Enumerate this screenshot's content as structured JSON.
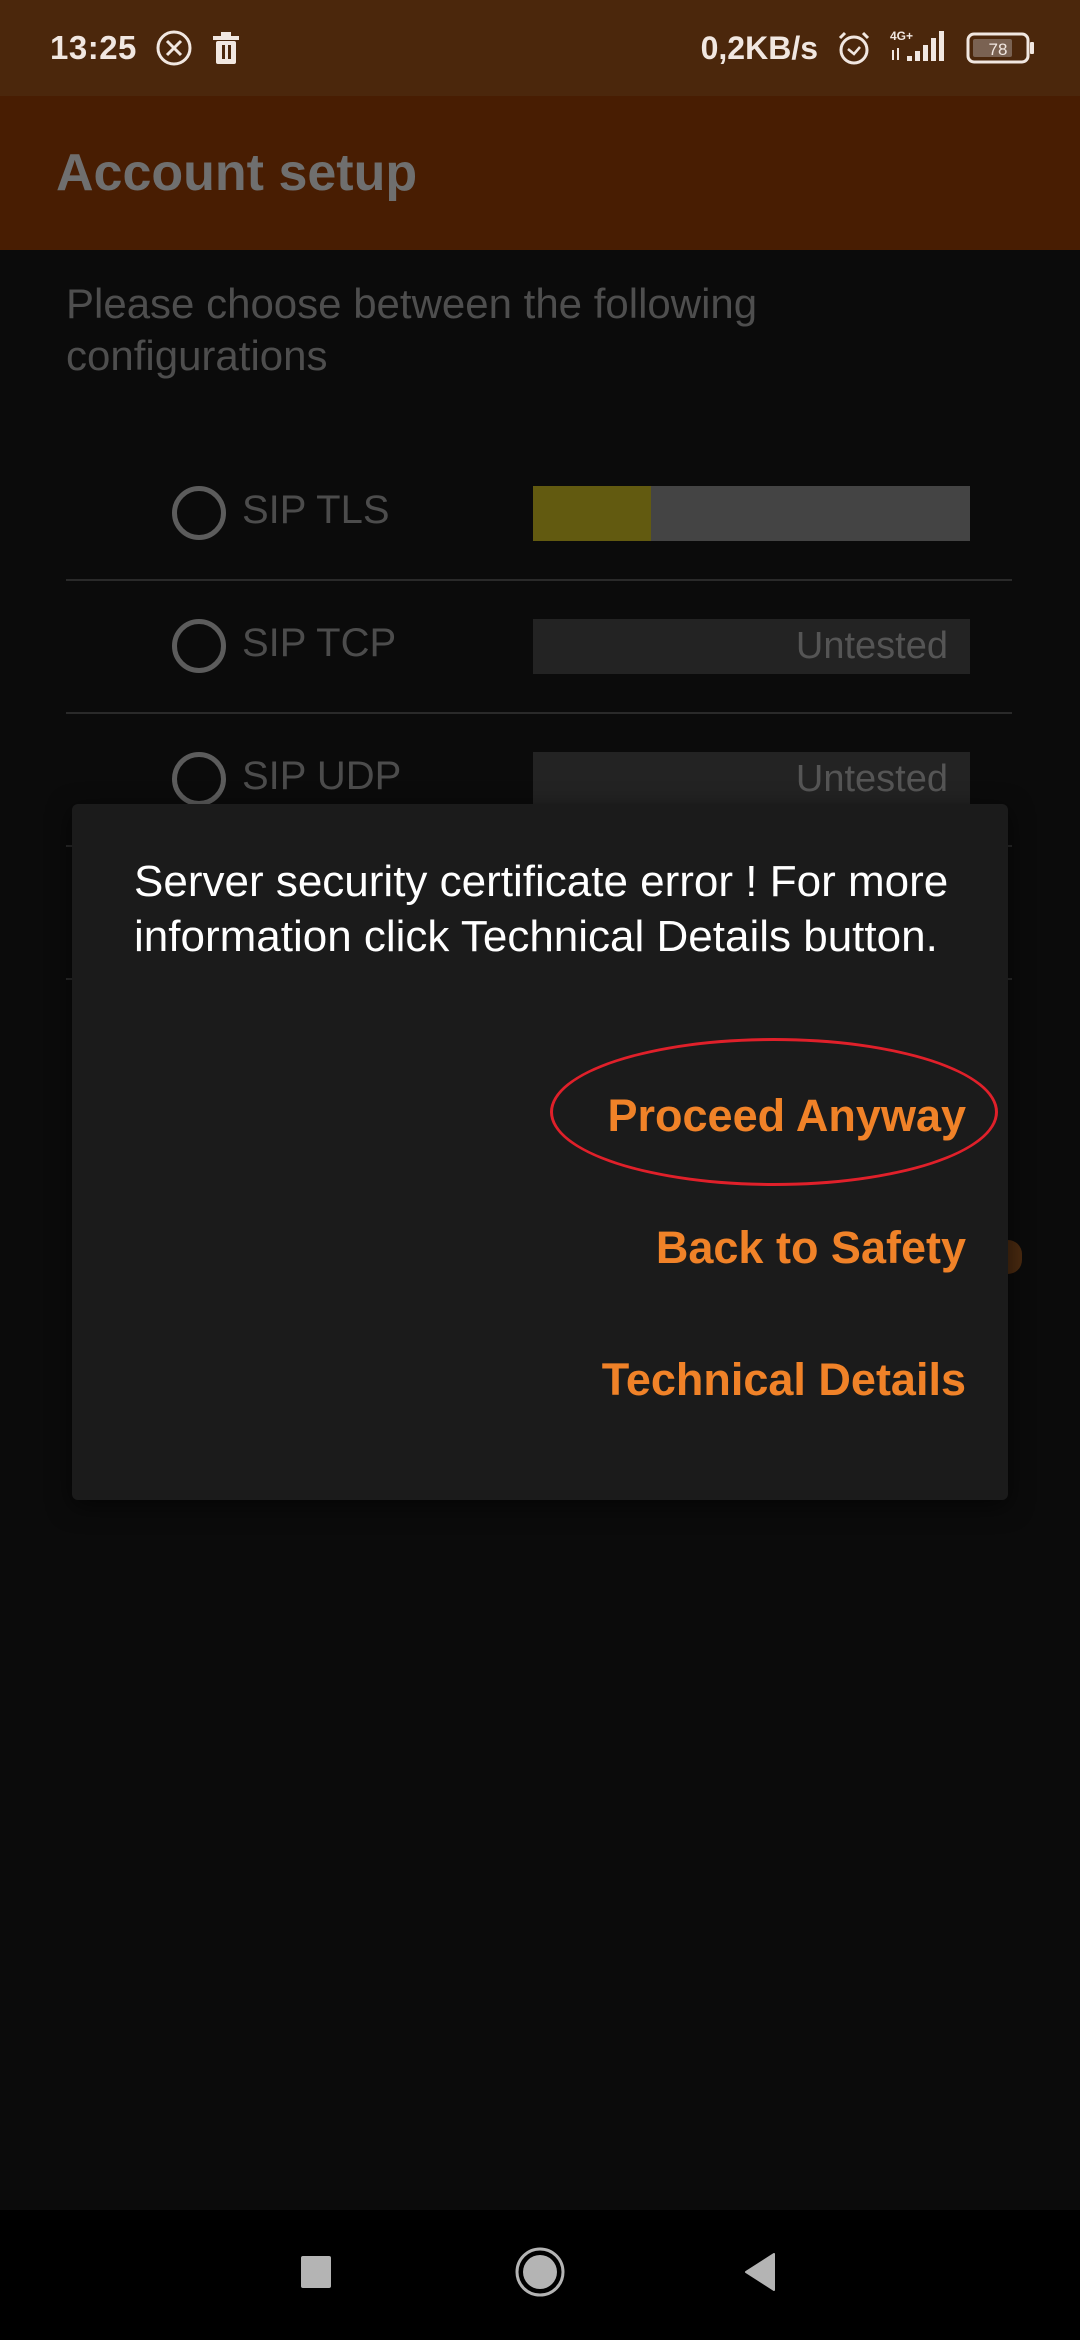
{
  "status_bar": {
    "time": "13:25",
    "left_icons": [
      "close-circle-icon",
      "trash-icon"
    ],
    "network_speed": "0,2KB/s",
    "network_type": "4G+",
    "battery_level": "78",
    "right_icons": [
      "alarm-icon",
      "signal-icon",
      "battery-icon"
    ]
  },
  "app_bar": {
    "title": "Account setup"
  },
  "main": {
    "instruction": "Please choose between the following configurations",
    "configurations": [
      {
        "label": "SIP TLS",
        "status": "",
        "progress": 0.27,
        "selected": false
      },
      {
        "label": "SIP TCP",
        "status": "Untested",
        "selected": false
      },
      {
        "label": "SIP UDP",
        "status": "Untested",
        "selected": false
      }
    ]
  },
  "dialog": {
    "message": "Server security certificate error ! For more information click Technical Details button.",
    "buttons": {
      "proceed": "Proceed Anyway",
      "back": "Back to Safety",
      "technical": "Technical Details"
    },
    "highlighted_button": "proceed"
  },
  "colors": {
    "accent": "#f08228",
    "status_bar": "#4b270c",
    "app_bar": "#481d02",
    "dialog_bg": "#1b1b1b",
    "highlight": "#e0202a",
    "progress_fill": "#625a10"
  },
  "nav_bar": {
    "buttons": [
      "recent-apps",
      "home",
      "back"
    ]
  }
}
